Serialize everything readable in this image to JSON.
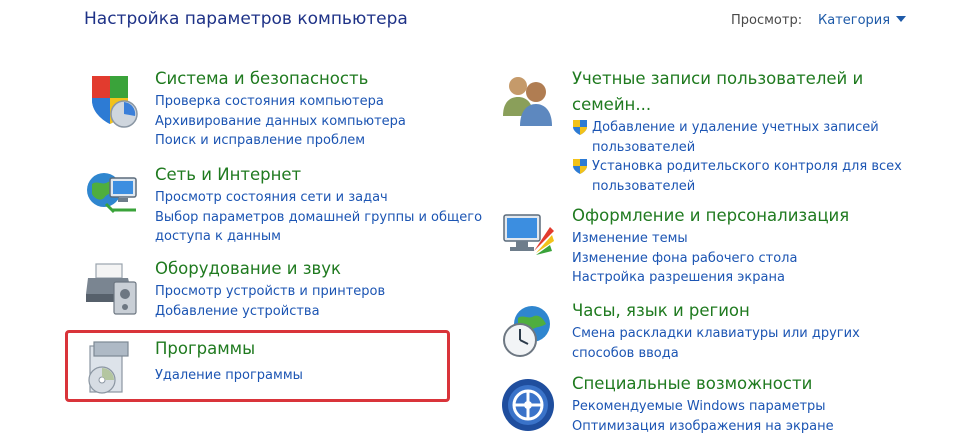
{
  "header": {
    "title": "Настройка параметров компьютера",
    "view_label": "Просмотр:",
    "view_value": "Категория"
  },
  "categories": [
    {
      "title": "Система и безопасность",
      "icon": "shield-icon",
      "links": [
        "Проверка состояния компьютера",
        "Архивирование данных компьютера",
        "Поиск и исправление проблем"
      ]
    },
    {
      "title": "Сеть и Интернет",
      "icon": "network-globe-icon",
      "links": [
        "Просмотр состояния сети и задач",
        "Выбор параметров домашней группы и общего",
        "доступа к данным"
      ]
    },
    {
      "title": "Оборудование и звук",
      "icon": "printer-icon",
      "links": [
        "Просмотр устройств и принтеров",
        "Добавление устройства"
      ]
    },
    {
      "title": "Программы",
      "icon": "programs-disc-icon",
      "links": [
        "Удаление программы"
      ]
    },
    {
      "title": [
        "Учетные записи пользователей и",
        "семейн..."
      ],
      "icon": "users-icon",
      "links": [
        "Добавление и удаление учетных записей",
        "пользователей",
        "Установка родительского контроля для всех",
        "пользователей"
      ]
    },
    {
      "title": "Оформление и персонализация",
      "icon": "monitor-palette-icon",
      "links": [
        "Изменение темы",
        "Изменение фона рабочего стола",
        "Настройка разрешения экрана"
      ]
    },
    {
      "title": "Часы, язык и регион",
      "icon": "clock-globe-icon",
      "links": [
        "Смена раскладки клавиатуры или других",
        "способов ввода"
      ]
    },
    {
      "title": "Специальные возможности",
      "icon": "accessibility-icon",
      "links": [
        "Рекомендуемые Windows параметры",
        "Оптимизация изображения на экране"
      ]
    }
  ],
  "colors": {
    "title": "#1e3287",
    "category_title": "#1f7a1f",
    "link": "#1c55b3",
    "highlight": "#d9343a"
  }
}
